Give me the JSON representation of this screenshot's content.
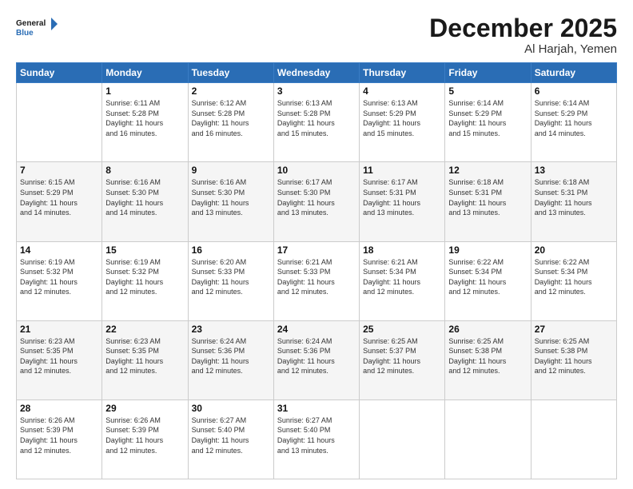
{
  "header": {
    "logo_line1": "General",
    "logo_line2": "Blue",
    "month": "December 2025",
    "location": "Al Harjah, Yemen"
  },
  "weekdays": [
    "Sunday",
    "Monday",
    "Tuesday",
    "Wednesday",
    "Thursday",
    "Friday",
    "Saturday"
  ],
  "weeks": [
    [
      {
        "day": "",
        "info": ""
      },
      {
        "day": "1",
        "info": "Sunrise: 6:11 AM\nSunset: 5:28 PM\nDaylight: 11 hours\nand 16 minutes."
      },
      {
        "day": "2",
        "info": "Sunrise: 6:12 AM\nSunset: 5:28 PM\nDaylight: 11 hours\nand 16 minutes."
      },
      {
        "day": "3",
        "info": "Sunrise: 6:13 AM\nSunset: 5:28 PM\nDaylight: 11 hours\nand 15 minutes."
      },
      {
        "day": "4",
        "info": "Sunrise: 6:13 AM\nSunset: 5:29 PM\nDaylight: 11 hours\nand 15 minutes."
      },
      {
        "day": "5",
        "info": "Sunrise: 6:14 AM\nSunset: 5:29 PM\nDaylight: 11 hours\nand 15 minutes."
      },
      {
        "day": "6",
        "info": "Sunrise: 6:14 AM\nSunset: 5:29 PM\nDaylight: 11 hours\nand 14 minutes."
      }
    ],
    [
      {
        "day": "7",
        "info": "Sunrise: 6:15 AM\nSunset: 5:29 PM\nDaylight: 11 hours\nand 14 minutes."
      },
      {
        "day": "8",
        "info": "Sunrise: 6:16 AM\nSunset: 5:30 PM\nDaylight: 11 hours\nand 14 minutes."
      },
      {
        "day": "9",
        "info": "Sunrise: 6:16 AM\nSunset: 5:30 PM\nDaylight: 11 hours\nand 13 minutes."
      },
      {
        "day": "10",
        "info": "Sunrise: 6:17 AM\nSunset: 5:30 PM\nDaylight: 11 hours\nand 13 minutes."
      },
      {
        "day": "11",
        "info": "Sunrise: 6:17 AM\nSunset: 5:31 PM\nDaylight: 11 hours\nand 13 minutes."
      },
      {
        "day": "12",
        "info": "Sunrise: 6:18 AM\nSunset: 5:31 PM\nDaylight: 11 hours\nand 13 minutes."
      },
      {
        "day": "13",
        "info": "Sunrise: 6:18 AM\nSunset: 5:31 PM\nDaylight: 11 hours\nand 13 minutes."
      }
    ],
    [
      {
        "day": "14",
        "info": "Sunrise: 6:19 AM\nSunset: 5:32 PM\nDaylight: 11 hours\nand 12 minutes."
      },
      {
        "day": "15",
        "info": "Sunrise: 6:19 AM\nSunset: 5:32 PM\nDaylight: 11 hours\nand 12 minutes."
      },
      {
        "day": "16",
        "info": "Sunrise: 6:20 AM\nSunset: 5:33 PM\nDaylight: 11 hours\nand 12 minutes."
      },
      {
        "day": "17",
        "info": "Sunrise: 6:21 AM\nSunset: 5:33 PM\nDaylight: 11 hours\nand 12 minutes."
      },
      {
        "day": "18",
        "info": "Sunrise: 6:21 AM\nSunset: 5:34 PM\nDaylight: 11 hours\nand 12 minutes."
      },
      {
        "day": "19",
        "info": "Sunrise: 6:22 AM\nSunset: 5:34 PM\nDaylight: 11 hours\nand 12 minutes."
      },
      {
        "day": "20",
        "info": "Sunrise: 6:22 AM\nSunset: 5:34 PM\nDaylight: 11 hours\nand 12 minutes."
      }
    ],
    [
      {
        "day": "21",
        "info": "Sunrise: 6:23 AM\nSunset: 5:35 PM\nDaylight: 11 hours\nand 12 minutes."
      },
      {
        "day": "22",
        "info": "Sunrise: 6:23 AM\nSunset: 5:35 PM\nDaylight: 11 hours\nand 12 minutes."
      },
      {
        "day": "23",
        "info": "Sunrise: 6:24 AM\nSunset: 5:36 PM\nDaylight: 11 hours\nand 12 minutes."
      },
      {
        "day": "24",
        "info": "Sunrise: 6:24 AM\nSunset: 5:36 PM\nDaylight: 11 hours\nand 12 minutes."
      },
      {
        "day": "25",
        "info": "Sunrise: 6:25 AM\nSunset: 5:37 PM\nDaylight: 11 hours\nand 12 minutes."
      },
      {
        "day": "26",
        "info": "Sunrise: 6:25 AM\nSunset: 5:38 PM\nDaylight: 11 hours\nand 12 minutes."
      },
      {
        "day": "27",
        "info": "Sunrise: 6:25 AM\nSunset: 5:38 PM\nDaylight: 11 hours\nand 12 minutes."
      }
    ],
    [
      {
        "day": "28",
        "info": "Sunrise: 6:26 AM\nSunset: 5:39 PM\nDaylight: 11 hours\nand 12 minutes."
      },
      {
        "day": "29",
        "info": "Sunrise: 6:26 AM\nSunset: 5:39 PM\nDaylight: 11 hours\nand 12 minutes."
      },
      {
        "day": "30",
        "info": "Sunrise: 6:27 AM\nSunset: 5:40 PM\nDaylight: 11 hours\nand 12 minutes."
      },
      {
        "day": "31",
        "info": "Sunrise: 6:27 AM\nSunset: 5:40 PM\nDaylight: 11 hours\nand 13 minutes."
      },
      {
        "day": "",
        "info": ""
      },
      {
        "day": "",
        "info": ""
      },
      {
        "day": "",
        "info": ""
      }
    ]
  ]
}
